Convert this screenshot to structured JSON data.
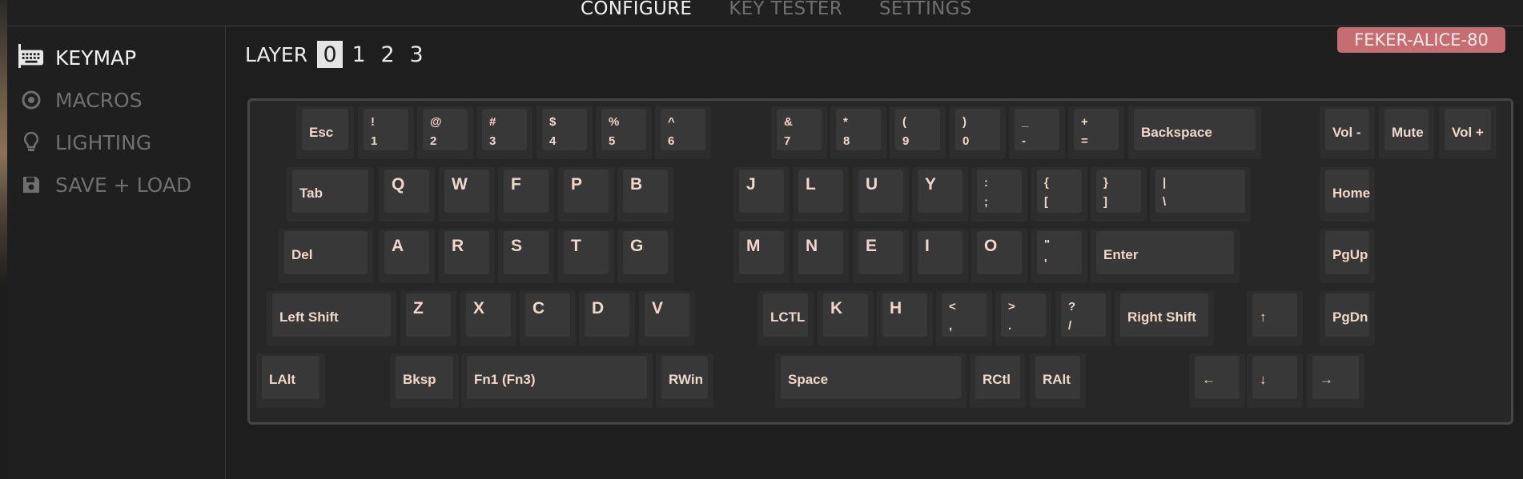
{
  "top_nav": [
    "CONFIGURE",
    "KEY TESTER",
    "SETTINGS"
  ],
  "sidebar": [
    {
      "label": "KEYMAP",
      "icon": "keyboard-icon",
      "active": true
    },
    {
      "label": "MACROS",
      "icon": "record-icon",
      "active": false
    },
    {
      "label": "LIGHTING",
      "icon": "lightbulb-icon",
      "active": false
    },
    {
      "label": "SAVE + LOAD",
      "icon": "floppy-icon",
      "active": false
    }
  ],
  "layer_label": "LAYER",
  "layers": [
    "0",
    "1",
    "2",
    "3"
  ],
  "selected_layer": "0",
  "device_name": "FEKER-ALICE-80",
  "colors": {
    "background": "#1e1e1e",
    "key_text": "#f0d7c9",
    "badge": "#c56d70",
    "active_text": "#f0f0f0",
    "inactive_text": "#6f6f6f"
  },
  "keys": [
    {
      "top": "",
      "bottom": "Esc"
    },
    {
      "top": "!",
      "bottom": "1"
    },
    {
      "top": "@",
      "bottom": "2"
    },
    {
      "top": "#",
      "bottom": "3"
    },
    {
      "top": "$",
      "bottom": "4"
    },
    {
      "top": "%",
      "bottom": "5"
    },
    {
      "top": "^",
      "bottom": "6"
    },
    {
      "top": "&",
      "bottom": "7"
    },
    {
      "top": "*",
      "bottom": "8"
    },
    {
      "top": "(",
      "bottom": "9"
    },
    {
      "top": ")",
      "bottom": "0"
    },
    {
      "top": "_",
      "bottom": "-"
    },
    {
      "top": "+",
      "bottom": "="
    },
    {
      "top": "",
      "bottom": "Backspace"
    },
    {
      "top": "",
      "bottom": "Vol -"
    },
    {
      "top": "",
      "bottom": "Mute"
    },
    {
      "top": "",
      "bottom": "Vol +"
    },
    {
      "top": "",
      "bottom": "Tab"
    },
    {
      "top": "Q",
      "bottom": ""
    },
    {
      "top": "W",
      "bottom": ""
    },
    {
      "top": "F",
      "bottom": ""
    },
    {
      "top": "P",
      "bottom": ""
    },
    {
      "top": "B",
      "bottom": ""
    },
    {
      "top": "J",
      "bottom": ""
    },
    {
      "top": "L",
      "bottom": ""
    },
    {
      "top": "U",
      "bottom": ""
    },
    {
      "top": "Y",
      "bottom": ""
    },
    {
      "top": ":",
      "bottom": ";"
    },
    {
      "top": "{",
      "bottom": "["
    },
    {
      "top": "}",
      "bottom": "]"
    },
    {
      "top": "|",
      "bottom": "\\"
    },
    {
      "top": "",
      "bottom": "Home"
    },
    {
      "top": "",
      "bottom": "Del"
    },
    {
      "top": "A",
      "bottom": ""
    },
    {
      "top": "R",
      "bottom": ""
    },
    {
      "top": "S",
      "bottom": ""
    },
    {
      "top": "T",
      "bottom": ""
    },
    {
      "top": "G",
      "bottom": ""
    },
    {
      "top": "M",
      "bottom": ""
    },
    {
      "top": "N",
      "bottom": ""
    },
    {
      "top": "E",
      "bottom": ""
    },
    {
      "top": "I",
      "bottom": ""
    },
    {
      "top": "O",
      "bottom": ""
    },
    {
      "top": "\"",
      "bottom": "'"
    },
    {
      "top": "",
      "bottom": "Enter"
    },
    {
      "top": "",
      "bottom": "PgUp"
    },
    {
      "top": "",
      "bottom": "Left Shift"
    },
    {
      "top": "Z",
      "bottom": ""
    },
    {
      "top": "X",
      "bottom": ""
    },
    {
      "top": "C",
      "bottom": ""
    },
    {
      "top": "D",
      "bottom": ""
    },
    {
      "top": "V",
      "bottom": ""
    },
    {
      "top": "",
      "bottom": "LCTL"
    },
    {
      "top": "K",
      "bottom": ""
    },
    {
      "top": "H",
      "bottom": ""
    },
    {
      "top": "<",
      "bottom": ","
    },
    {
      "top": ">",
      "bottom": "."
    },
    {
      "top": "?",
      "bottom": "/"
    },
    {
      "top": "",
      "bottom": "Right Shift"
    },
    {
      "top": "",
      "bottom": "↑"
    },
    {
      "top": "",
      "bottom": "PgDn"
    },
    {
      "top": "",
      "bottom": "LAlt"
    },
    {
      "top": "",
      "bottom": "Bksp"
    },
    {
      "top": "",
      "bottom": "Fn1 (Fn3)"
    },
    {
      "top": "",
      "bottom": "RWin"
    },
    {
      "top": "",
      "bottom": "Space"
    },
    {
      "top": "",
      "bottom": "RCtl"
    },
    {
      "top": "",
      "bottom": "RAlt"
    },
    {
      "top": "",
      "bottom": "←"
    },
    {
      "top": "",
      "bottom": "↓"
    },
    {
      "top": "",
      "bottom": "→"
    }
  ]
}
